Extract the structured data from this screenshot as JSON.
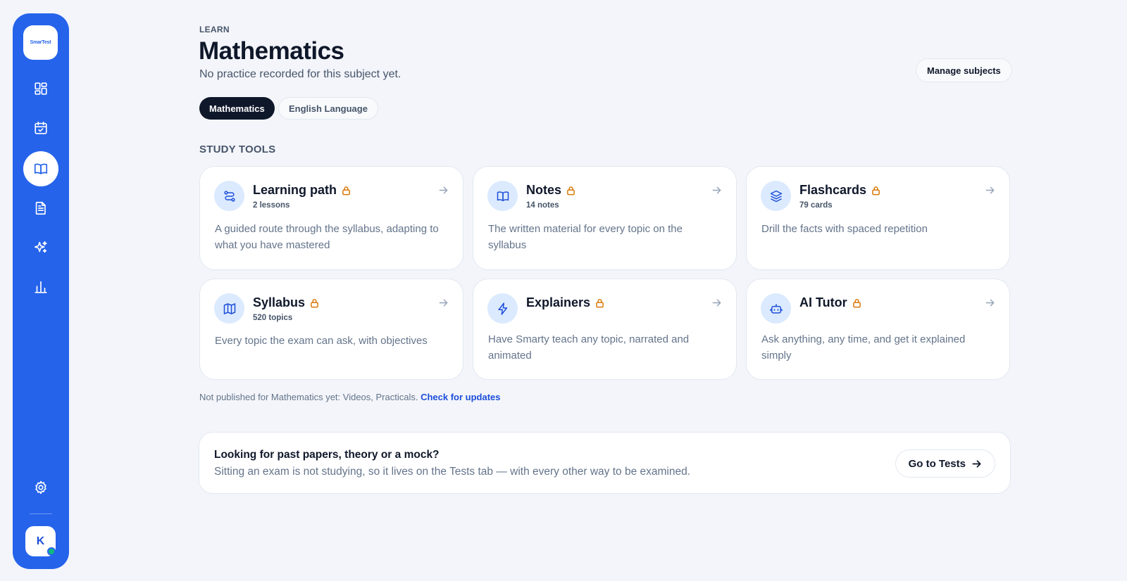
{
  "app": {
    "logo_text": "SmarTest"
  },
  "sidebar": {
    "items": [
      {
        "name": "dashboard",
        "icon": "dashboard-icon"
      },
      {
        "name": "calendar",
        "icon": "calendar-check-icon"
      },
      {
        "name": "learn",
        "icon": "book-open-icon",
        "active": true
      },
      {
        "name": "tests",
        "icon": "document-icon"
      },
      {
        "name": "ai",
        "icon": "sparkles-icon"
      },
      {
        "name": "stats",
        "icon": "bar-chart-icon"
      }
    ],
    "settings_icon": "gear-icon",
    "avatar_initial": "K"
  },
  "header": {
    "eyebrow": "LEARN",
    "title": "Mathematics",
    "subtitle": "No practice recorded for this subject yet.",
    "manage_label": "Manage subjects"
  },
  "subjects": [
    {
      "label": "Mathematics",
      "active": true
    },
    {
      "label": "English Language",
      "active": false
    }
  ],
  "section_label": "STUDY TOOLS",
  "tools": [
    {
      "title": "Learning path",
      "count": "2 lessons",
      "desc": "A guided route through the syllabus, adapting to what you have mastered",
      "icon": "route-icon",
      "locked": true
    },
    {
      "title": "Notes",
      "count": "14 notes",
      "desc": "The written material for every topic on the syllabus",
      "icon": "book-open-icon",
      "locked": true
    },
    {
      "title": "Flashcards",
      "count": "79 cards",
      "desc": "Drill the facts with spaced repetition",
      "icon": "layers-icon",
      "locked": true
    },
    {
      "title": "Syllabus",
      "count": "520 topics",
      "desc": "Every topic the exam can ask, with objectives",
      "icon": "map-icon",
      "locked": true
    },
    {
      "title": "Explainers",
      "count": "",
      "desc": "Have Smarty teach any topic, narrated and animated",
      "icon": "lightning-icon",
      "locked": true
    },
    {
      "title": "AI Tutor",
      "count": "",
      "desc": "Ask anything, any time, and get it explained simply",
      "icon": "robot-icon",
      "locked": true
    }
  ],
  "footnote": {
    "text": "Not published for Mathematics yet: Videos, Practicals.",
    "link": "Check for updates"
  },
  "cta": {
    "title": "Looking for past papers, theory or a mock?",
    "desc": "Sitting an exam is not studying, so it lives on the Tests tab — with every other way to be examined.",
    "button": "Go to Tests"
  },
  "colors": {
    "accent": "#2563eb",
    "lock": "#d97706",
    "online": "#10b981"
  }
}
